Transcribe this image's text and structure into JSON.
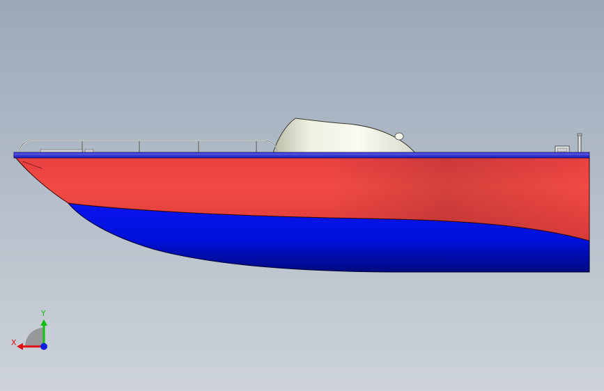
{
  "viewport": {
    "background_top": "#9aa8b9",
    "background_bottom": "#ced3da"
  },
  "model": {
    "hull_upper_color": "#ee4040",
    "hull_lower_color": "#0010e0",
    "deck_rail_color": "#3a3ad8",
    "cabin_color": "#e8ecd8",
    "railing_color": "#d8d8d8"
  },
  "triad": {
    "x_label": "X",
    "y_label": "Y",
    "x_color": "#e01010",
    "y_color": "#10c010",
    "z_color": "#1020e0"
  }
}
